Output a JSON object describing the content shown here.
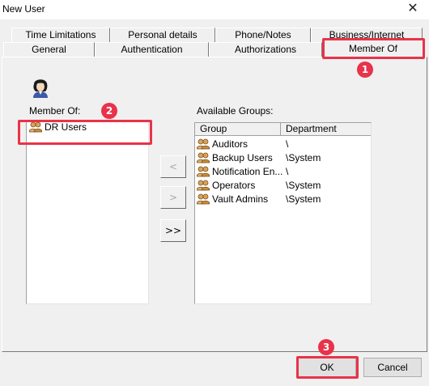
{
  "window": {
    "title": "New User",
    "close_glyph": "✕"
  },
  "tabs": {
    "back_row": [
      "Time Limitations",
      "Personal details",
      "Phone/Notes",
      "Business/Internet"
    ],
    "front_row": [
      "General",
      "Authentication",
      "Authorizations"
    ],
    "active": "Member Of"
  },
  "member_of": {
    "label": "Member Of:",
    "items": [
      "DR Users"
    ]
  },
  "available_groups": {
    "label": "Available Groups:",
    "columns": [
      "Group",
      "Department"
    ],
    "rows": [
      {
        "group": "Auditors",
        "department": "\\"
      },
      {
        "group": "Backup Users",
        "department": "\\System"
      },
      {
        "group": "Notification En...",
        "department": "\\"
      },
      {
        "group": "Operators",
        "department": "\\System"
      },
      {
        "group": "Vault Admins",
        "department": "\\System"
      }
    ]
  },
  "transfer_buttons": {
    "add": "<",
    "remove": ">",
    "add_all": ">>"
  },
  "footer": {
    "ok": "OK",
    "cancel": "Cancel"
  },
  "callouts": [
    "1",
    "2",
    "3"
  ],
  "colors": {
    "highlight": "#e8334a",
    "dialog_bg": "#f0f0f0"
  },
  "icons": {
    "user": "user-avatar-icon",
    "group": "group-icon"
  }
}
